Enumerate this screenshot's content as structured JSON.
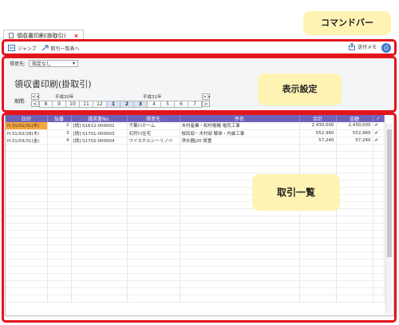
{
  "tab": {
    "label": "領収書印刷(掛取引)",
    "close": "×"
  },
  "command_bar": {
    "jump_label": "ジャンプ",
    "list_label": "取引一覧表へ",
    "send_memo_label": "送付メモ"
  },
  "settings": {
    "destination_label": "得意先:",
    "destination_value": "指定なし",
    "title": "領収書印刷(掛取引)",
    "period_label": "期間:",
    "era_left": "平成30年",
    "era_right": "平成31年",
    "months": [
      "8",
      "9",
      "10",
      "11",
      "12",
      "1",
      "2",
      "3",
      "4",
      "5",
      "6",
      "7"
    ],
    "selected_months": [
      "1",
      "2",
      "3"
    ],
    "nav_first": "<<",
    "nav_prev": "<",
    "nav_next": ">",
    "nav_last": ">>"
  },
  "table": {
    "columns": [
      "日付",
      "伝番",
      "請求書No.",
      "得意先",
      "件名",
      "合計",
      "金額",
      "✓"
    ],
    "rows": [
      {
        "date": "H.31/01/31(木)",
        "no": "2",
        "kind": "[請]",
        "invoice": "S1612-000002",
        "customer": "千葉川ホーム",
        "subject": "木村産業・松村電機 電気工事",
        "total": "2,430,000",
        "amount": "2,430,000",
        "check": "✔"
      },
      {
        "date": "H.31/02/28(木)",
        "no": "3",
        "kind": "[請]",
        "invoice": "S1701-000003",
        "customer": "石狩川住宅",
        "subject": "桜田邸・木村邸 解体・内装工事",
        "total": "552,960",
        "amount": "552,960",
        "check": "✔"
      },
      {
        "date": "H.31/03/31(金)",
        "no": "4",
        "kind": "[請]",
        "invoice": "S1702-000004",
        "customer": "ワイスホルシーリノベ",
        "subject": "浄水器J20 設置",
        "total": "57,240",
        "amount": "57,240",
        "check": "✔"
      }
    ]
  },
  "callouts": {
    "command_bar": "コマンドバー",
    "display_settings": "表示設定",
    "transaction_list": "取引一覧"
  },
  "colors": {
    "header_purple": "#6f63b8",
    "highlight_red": "#e3141b",
    "callout_yellow": "#fff3b3",
    "selected_cell": "#f7a63e"
  }
}
